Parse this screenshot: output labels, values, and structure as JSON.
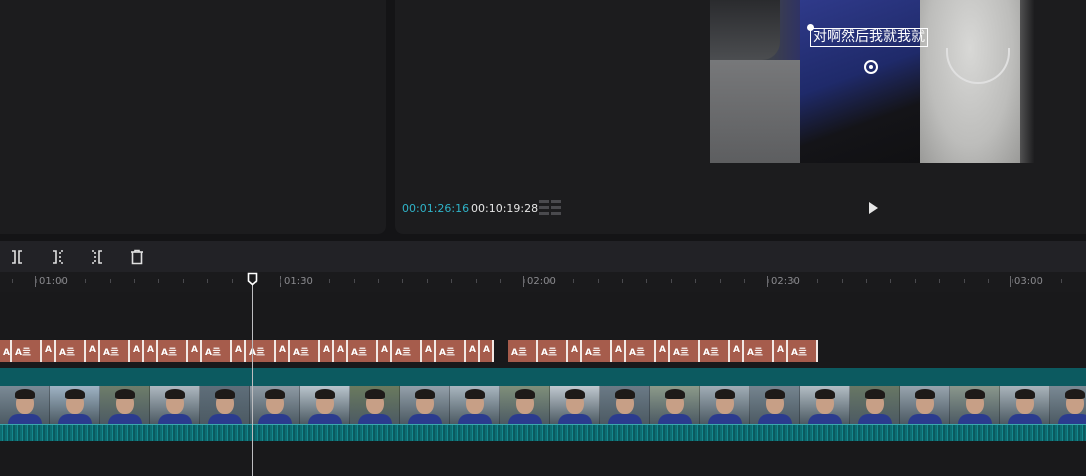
{
  "player": {
    "subtitle_text": "对啊然后我就我就",
    "current_time": "00:01:26:16",
    "total_time": "00:10:19:28"
  },
  "ruler": {
    "labels": [
      "01:00",
      "01:30",
      "02:00",
      "02:30",
      "03:00"
    ]
  },
  "timeline": {
    "text_clip_glyphs": [
      "A亖",
      "A亖",
      "A",
      "A亖",
      "A",
      "A亖",
      "A",
      "A",
      "A亖",
      "A",
      "A亖",
      "A",
      "A亖",
      "A",
      "A亖",
      "A",
      "A",
      "A亖",
      "A",
      "A亖",
      "A",
      "A亖",
      "A",
      "A",
      "A亖",
      "A亖",
      "A",
      "A亖",
      "A",
      "A亖",
      "A",
      "A亖",
      "A亖",
      "A",
      "A亖",
      "A",
      "A亖"
    ],
    "playhead_time": "00:01:26:16"
  },
  "colors": {
    "accent_timecode": "#2fb3c8",
    "text_clip": "#a65c4c",
    "audio_track": "#0d6d72"
  },
  "icons": {
    "split": "split-icon",
    "trim_left": "trim-left-icon",
    "trim_right": "trim-right-icon",
    "delete": "trash-icon",
    "play": "play-icon",
    "grid": "grid-icon"
  }
}
